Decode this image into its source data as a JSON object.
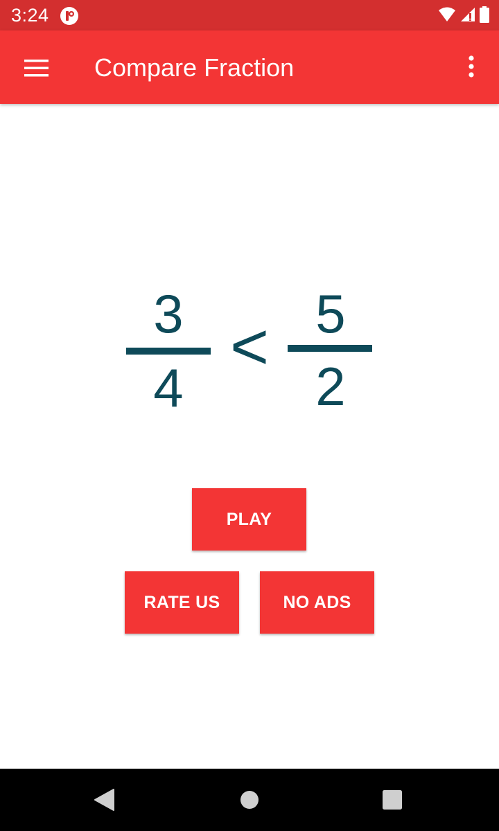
{
  "status_bar": {
    "time": "3:24",
    "app_notification_icon": "pinwheel-logo-icon",
    "icons": [
      "wifi-icon",
      "cell-signal-icon",
      "battery-icon"
    ]
  },
  "app_bar": {
    "title": "Compare Fraction",
    "menu_icon": "hamburger-menu-icon",
    "overflow_icon": "more-vert-icon"
  },
  "fraction": {
    "left_numerator": "3",
    "left_denominator": "4",
    "operator": "<",
    "right_numerator": "5",
    "right_denominator": "2"
  },
  "buttons": {
    "play": "PLAY",
    "rate_us": "RATE US",
    "no_ads": "NO ADS"
  },
  "nav_bar": {
    "back_icon": "back-triangle-icon",
    "home_icon": "home-circle-icon",
    "recents_icon": "recents-square-icon"
  },
  "colors": {
    "status_bar": "#d32f2f",
    "app_bar": "#f33535",
    "button": "#f33535",
    "fraction_text": "#0e4a59"
  }
}
